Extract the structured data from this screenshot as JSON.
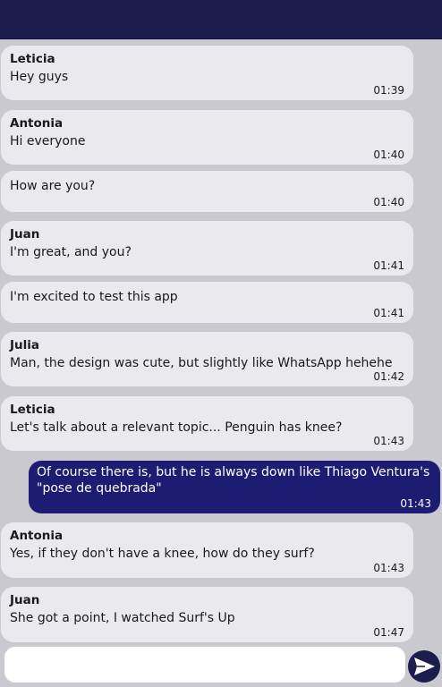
{
  "header": {
    "title": ""
  },
  "messages": [
    {
      "sender": "Leticia",
      "text": "Hey guys",
      "time": "01:39"
    },
    {
      "sender": "Antonia",
      "text": "Hi everyone",
      "time": "01:40"
    },
    {
      "sender": "",
      "text": "How are you?",
      "time": "01:40"
    },
    {
      "sender": "Juan",
      "text": "I'm great, and you?",
      "time": "01:41"
    },
    {
      "sender": "",
      "text": "I'm excited to test this app",
      "time": "01:41"
    },
    {
      "sender": "Julia",
      "text": "Man, the design was cute, but slightly like WhatsApp hehehe",
      "time": "01:42"
    },
    {
      "sender": "Leticia",
      "text": "Let's talk about a relevant topic... Penguin has knee?",
      "time": "01:43"
    },
    {
      "sender": "",
      "text": "Of course there is, but he is always down like Thiago Ventura's \"pose de quebrada\"",
      "time": "01:43",
      "own": true
    },
    {
      "sender": "Antonia",
      "text": "Yes, if they don't have a knee, how do they surf?",
      "time": "01:43"
    },
    {
      "sender": "Juan",
      "text": "She got a point, I watched Surf's Up",
      "time": "01:47"
    }
  ],
  "composer": {
    "placeholder": "",
    "value": "",
    "send_icon": "send-arrow-icon"
  },
  "colors": {
    "header": "#1c1c4e",
    "incoming": "#e9e9ee",
    "outgoing": "#1c1c72",
    "background": "#c9c9cf"
  }
}
